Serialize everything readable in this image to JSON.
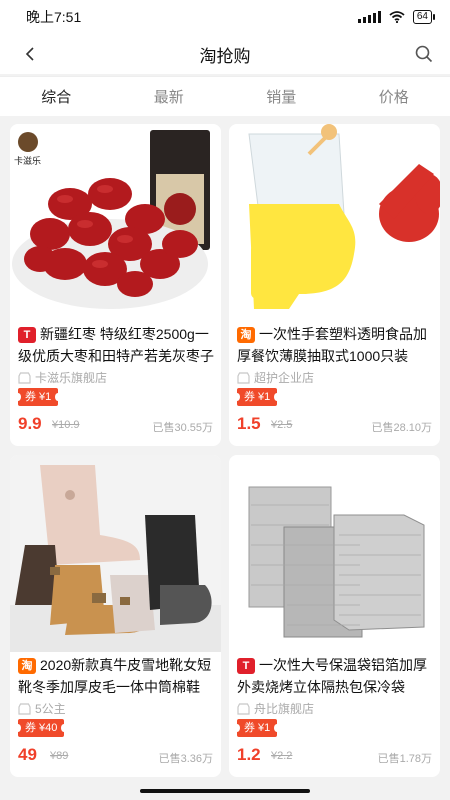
{
  "status_bar": {
    "time": "晚上7:51",
    "battery": "64"
  },
  "nav": {
    "title": "淘抢购",
    "back_icon": "chevron-left-icon",
    "search_icon": "search-icon"
  },
  "tabs": [
    {
      "label": "综合",
      "active": true
    },
    {
      "label": "最新",
      "active": false
    },
    {
      "label": "销量",
      "active": false
    },
    {
      "label": "价格",
      "active": false
    }
  ],
  "products": [
    {
      "platform": "tmall",
      "platform_label": "T",
      "title": "新疆红枣 特级红枣2500g一级优质大枣和田特产若羌灰枣子",
      "shop": "卡滋乐旗舰店",
      "coupon": "券 ¥1",
      "price": "9.9",
      "old_price": "¥10.9",
      "sold": "已售30.55万",
      "brand_text": "卡滋乐"
    },
    {
      "platform": "taobao",
      "platform_label": "淘",
      "title": "一次性手套塑料透明食品加厚餐饮薄膜抽取式1000只装",
      "shop": "超护企业店",
      "coupon": "券 ¥1",
      "price": "1.5",
      "old_price": "¥2.5",
      "sold": "已售28.10万"
    },
    {
      "platform": "taobao",
      "platform_label": "淘",
      "title": "2020新款真牛皮雪地靴女短靴冬季加厚皮毛一体中筒棉鞋",
      "shop": "5公主",
      "coupon": "券 ¥40",
      "price": "49",
      "old_price": "¥89",
      "sold": "已售3.36万"
    },
    {
      "platform": "tmall",
      "platform_label": "T",
      "title": "一次性大号保温袋铝箔加厚外卖烧烤立体隔热包保冷袋",
      "shop": "舟比旗舰店",
      "coupon": "券 ¥1",
      "price": "1.2",
      "old_price": "¥2.2",
      "sold": "已售1.78万"
    }
  ],
  "colors": {
    "accent": "#f0402a",
    "tmall": "#e0202b",
    "taobao": "#ff6a00"
  }
}
